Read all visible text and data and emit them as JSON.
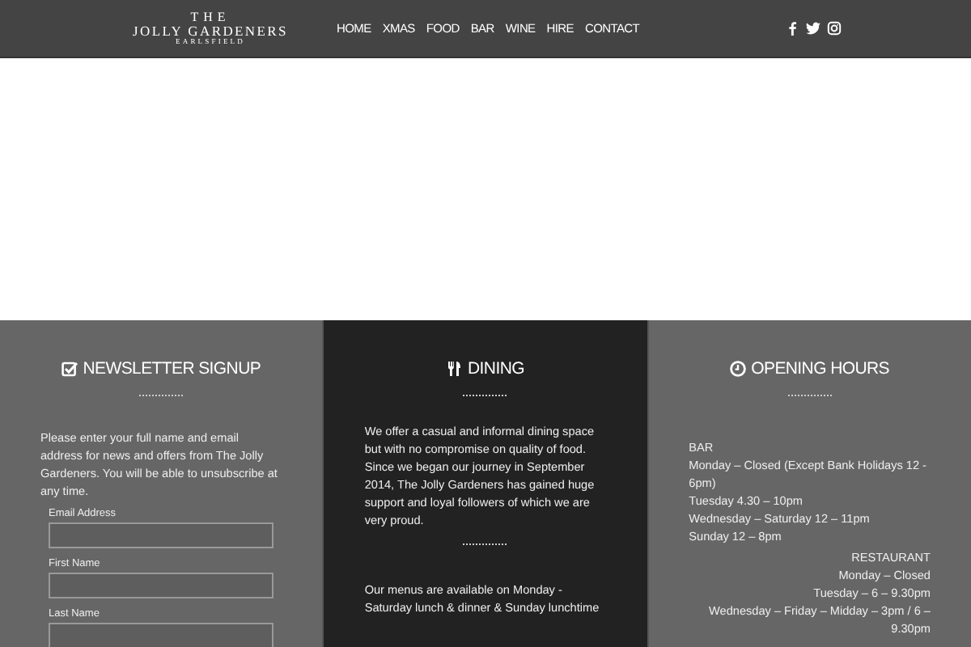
{
  "header": {
    "logo": {
      "top": "THE",
      "main": "JOLLY GARDENERS",
      "sub": "EARLSFIELD"
    },
    "nav": [
      "HOME",
      "XMAS",
      "FOOD",
      "BAR",
      "WINE",
      "HIRE",
      "CONTACT"
    ]
  },
  "newsletter": {
    "title": "NEWSLETTER SIGNUP",
    "intro": "Please enter your full name and email address for news and offers from The Jolly Gardeners. You will be able to unsubscribe at any time.",
    "fields": [
      {
        "label": "Email Address"
      },
      {
        "label": "First Name"
      },
      {
        "label": "Last Name"
      }
    ]
  },
  "dining": {
    "title": "DINING",
    "paragraphs": [
      "We offer a casual and informal dining space but with no compromise on quality of food. Since we began our journey in September 2014, The Jolly Gardeners has gained huge support and loyal followers of which we are very proud.",
      "Our menus are available on Monday - Saturday lunch & dinner & Sunday lunchtime"
    ]
  },
  "hours": {
    "title": "OPENING HOURS",
    "groups": [
      {
        "kind": "left",
        "lines": [
          "BAR",
          "Monday – Closed (Except Bank Holidays 12 - 6pm)",
          "Tuesday 4.30 – 10pm",
          "Wednesday – Saturday 12 – 11pm",
          "Sunday 12 – 8pm"
        ]
      },
      {
        "kind": "right",
        "lines": [
          "RESTAURANT",
          "Monday – Closed",
          "Tuesday – 6 – 9.30pm",
          "Wednesday – Friday – Midday – 3pm / 6 – 9.30pm"
        ]
      }
    ]
  }
}
